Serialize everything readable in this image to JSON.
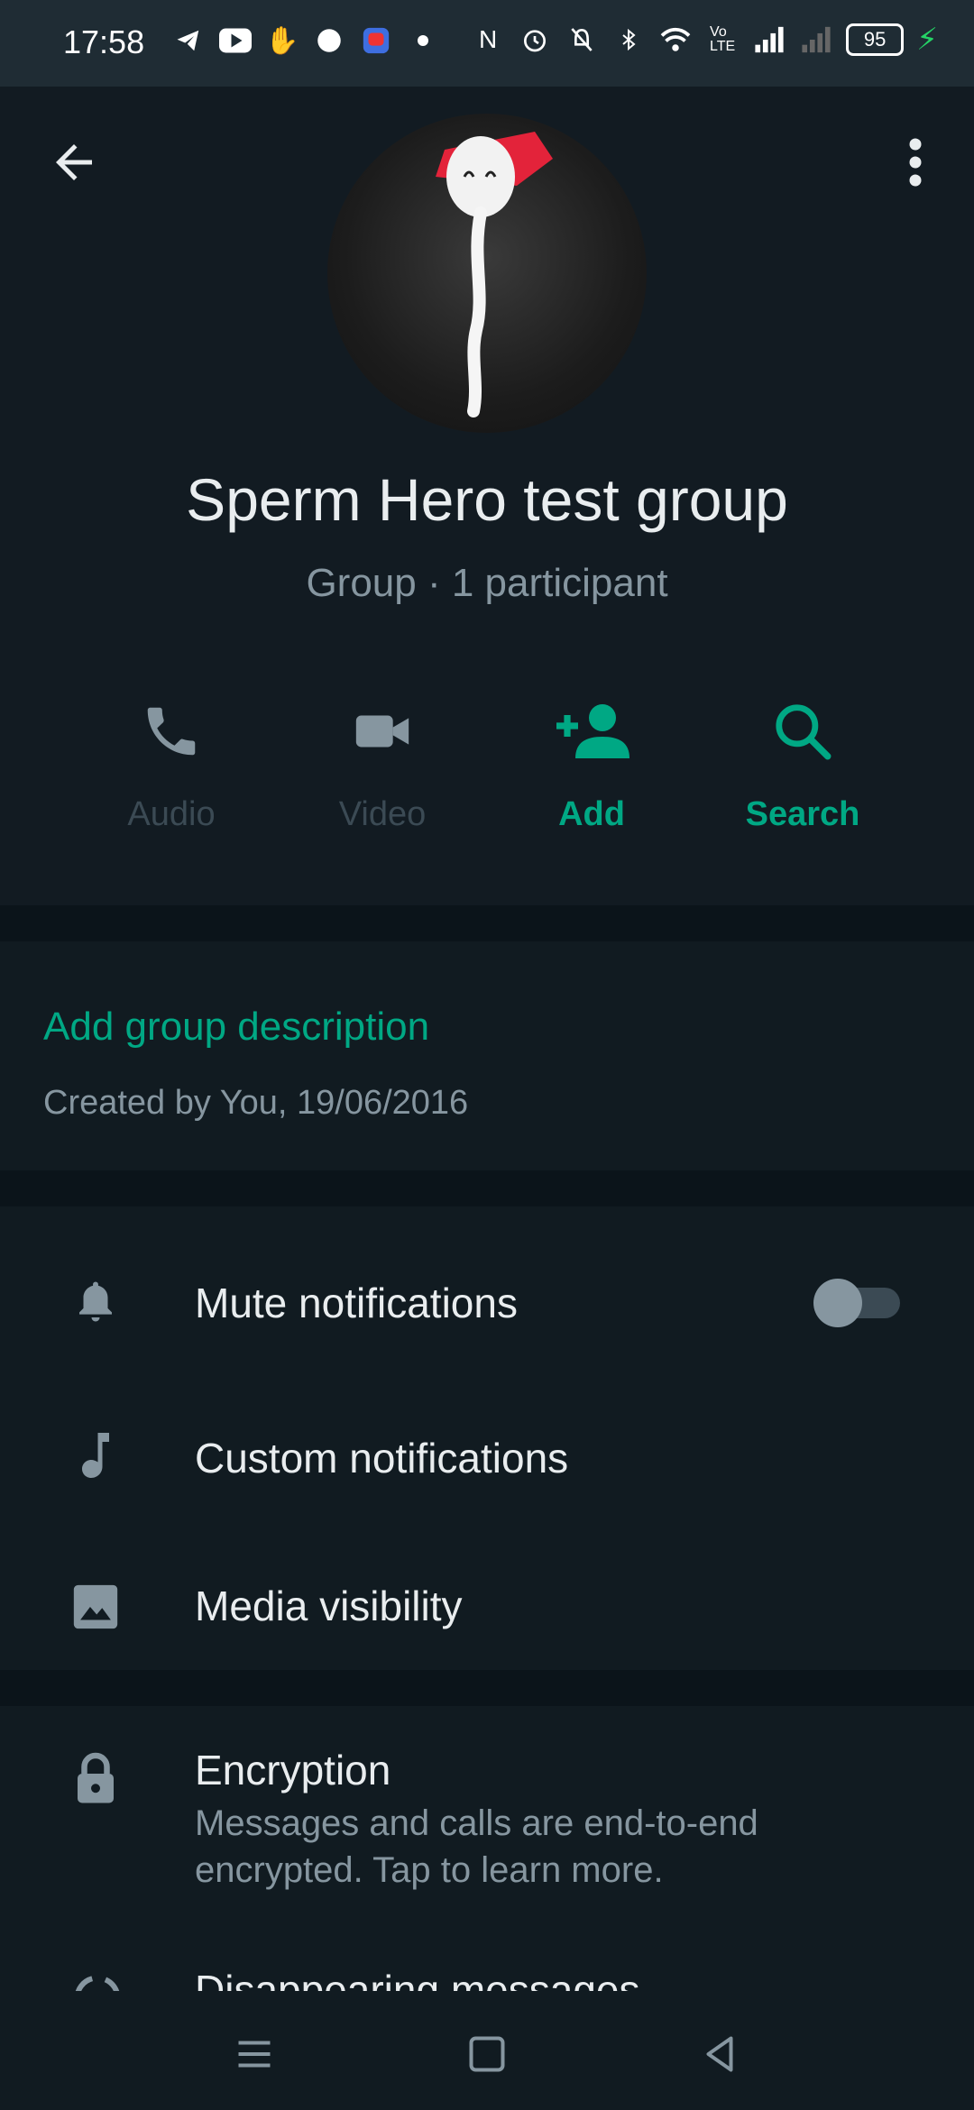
{
  "status_bar": {
    "time": "17:58",
    "battery": "95",
    "icons": [
      "telegram-icon",
      "youtube-icon",
      "wave-icon",
      "app-icon",
      "app-icon",
      "dot-icon",
      "nfc-icon",
      "alarm-icon",
      "vibrate-icon",
      "bluetooth-icon",
      "wifi-icon",
      "volte-icon",
      "signal-icon",
      "signal-off-icon",
      "battery-icon",
      "charging-icon"
    ]
  },
  "header": {
    "back_icon": "arrow-left-icon",
    "menu_icon": "more-vert-icon"
  },
  "group": {
    "name": "Sperm Hero test group",
    "subtitle": "Group · 1 participant"
  },
  "actions": [
    {
      "label": "Audio",
      "icon": "phone-icon",
      "enabled": false
    },
    {
      "label": "Video",
      "icon": "videocam-icon",
      "enabled": false
    },
    {
      "label": "Add",
      "icon": "person-add-icon",
      "enabled": true
    },
    {
      "label": "Search",
      "icon": "search-icon",
      "enabled": true
    }
  ],
  "description": {
    "add_label": "Add group description",
    "created": "Created by You, 19/06/2016"
  },
  "settings": {
    "mute": {
      "label": "Mute notifications",
      "icon": "bell-icon",
      "toggled": false
    },
    "custom": {
      "label": "Custom notifications",
      "icon": "music-note-icon"
    },
    "media": {
      "label": "Media visibility",
      "icon": "image-icon"
    }
  },
  "encryption": {
    "title": "Encryption",
    "description": "Messages and calls are end-to-end encrypted. Tap to learn more.",
    "icon": "lock-icon"
  },
  "disappearing": {
    "label": "Disappearing messages",
    "icon": "timer-icon"
  },
  "colors": {
    "accent": "#00a884",
    "background": "#111b21",
    "divider": "#0b141a",
    "secondary_text": "#8696a0"
  }
}
